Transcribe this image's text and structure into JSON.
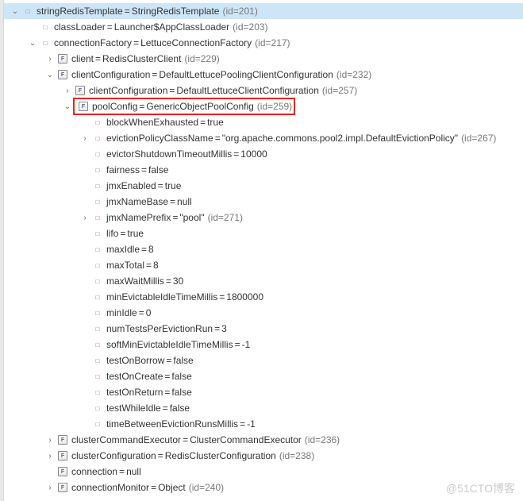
{
  "rows": [
    {
      "indent": 0,
      "twisty": "down",
      "icon": "field",
      "name": "stringRedisTemplate",
      "value": "StringRedisTemplate",
      "idref": "(id=201)",
      "selected": true
    },
    {
      "indent": 1,
      "twisty": "none",
      "icon": "field",
      "name": "classLoader",
      "value": "Launcher$AppClassLoader",
      "idref": "(id=203)"
    },
    {
      "indent": 1,
      "twisty": "down",
      "icon": "field",
      "name": "connectionFactory",
      "value": "LettuceConnectionFactory",
      "idref": "(id=217)"
    },
    {
      "indent": 2,
      "twisty": "right",
      "icon": "final",
      "name": "client",
      "value": "RedisClusterClient",
      "idref": "(id=229)"
    },
    {
      "indent": 2,
      "twisty": "down",
      "icon": "final",
      "name": "clientConfiguration",
      "value": "DefaultLettucePoolingClientConfiguration",
      "idref": "(id=232)"
    },
    {
      "indent": 3,
      "twisty": "right",
      "icon": "final",
      "name": "clientConfiguration",
      "value": "DefaultLettuceClientConfiguration",
      "idref": "(id=257)"
    },
    {
      "indent": 3,
      "twisty": "down",
      "icon": "final",
      "name": "poolConfig",
      "value": "GenericObjectPoolConfig",
      "idref": "(id=259)",
      "highlight": true
    },
    {
      "indent": 4,
      "twisty": "none",
      "icon": "field",
      "name": "blockWhenExhausted",
      "value": "true"
    },
    {
      "indent": 4,
      "twisty": "right",
      "icon": "field",
      "name": "evictionPolicyClassName",
      "value": "\"org.apache.commons.pool2.impl.DefaultEvictionPolicy\"",
      "idref": "(id=267)"
    },
    {
      "indent": 4,
      "twisty": "none",
      "icon": "field",
      "name": "evictorShutdownTimeoutMillis",
      "value": "10000"
    },
    {
      "indent": 4,
      "twisty": "none",
      "icon": "field",
      "name": "fairness",
      "value": "false"
    },
    {
      "indent": 4,
      "twisty": "none",
      "icon": "field",
      "name": "jmxEnabled",
      "value": "true"
    },
    {
      "indent": 4,
      "twisty": "none",
      "icon": "field",
      "name": "jmxNameBase",
      "value": "null"
    },
    {
      "indent": 4,
      "twisty": "right",
      "icon": "field",
      "name": "jmxNamePrefix",
      "value": "\"pool\"",
      "idref": "(id=271)"
    },
    {
      "indent": 4,
      "twisty": "none",
      "icon": "field",
      "name": "lifo",
      "value": "true"
    },
    {
      "indent": 4,
      "twisty": "none",
      "icon": "field",
      "name": "maxIdle",
      "value": "8"
    },
    {
      "indent": 4,
      "twisty": "none",
      "icon": "field",
      "name": "maxTotal",
      "value": "8"
    },
    {
      "indent": 4,
      "twisty": "none",
      "icon": "field",
      "name": "maxWaitMillis",
      "value": "30"
    },
    {
      "indent": 4,
      "twisty": "none",
      "icon": "field",
      "name": "minEvictableIdleTimeMillis",
      "value": "1800000"
    },
    {
      "indent": 4,
      "twisty": "none",
      "icon": "field",
      "name": "minIdle",
      "value": "0"
    },
    {
      "indent": 4,
      "twisty": "none",
      "icon": "field",
      "name": "numTestsPerEvictionRun",
      "value": "3"
    },
    {
      "indent": 4,
      "twisty": "none",
      "icon": "field",
      "name": "softMinEvictableIdleTimeMillis",
      "value": "-1"
    },
    {
      "indent": 4,
      "twisty": "none",
      "icon": "field",
      "name": "testOnBorrow",
      "value": "false"
    },
    {
      "indent": 4,
      "twisty": "none",
      "icon": "field",
      "name": "testOnCreate",
      "value": "false"
    },
    {
      "indent": 4,
      "twisty": "none",
      "icon": "field",
      "name": "testOnReturn",
      "value": "false"
    },
    {
      "indent": 4,
      "twisty": "none",
      "icon": "field",
      "name": "testWhileIdle",
      "value": "false"
    },
    {
      "indent": 4,
      "twisty": "none",
      "icon": "field",
      "name": "timeBetweenEvictionRunsMillis",
      "value": "-1"
    },
    {
      "indent": 2,
      "twisty": "right",
      "icon": "final",
      "name": "clusterCommandExecutor",
      "value": "ClusterCommandExecutor",
      "idref": "(id=236)"
    },
    {
      "indent": 2,
      "twisty": "right",
      "icon": "final",
      "name": "clusterConfiguration",
      "value": "RedisClusterConfiguration",
      "idref": "(id=238)"
    },
    {
      "indent": 2,
      "twisty": "none",
      "icon": "final",
      "name": "connection",
      "value": "null"
    },
    {
      "indent": 2,
      "twisty": "right",
      "icon": "final",
      "name": "connectionMonitor",
      "value": "Object",
      "idref": "(id=240)"
    }
  ],
  "watermark": "@51CTO博客"
}
